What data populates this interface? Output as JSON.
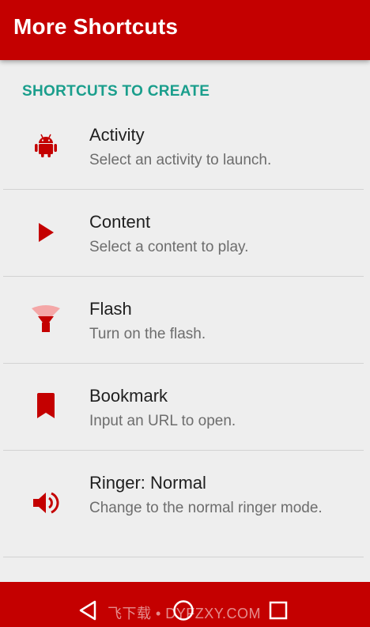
{
  "appbar": {
    "title": "More Shortcuts"
  },
  "section": {
    "header": "SHORTCUTS TO CREATE"
  },
  "items": [
    {
      "icon": "android-icon",
      "title": "Activity",
      "subtitle": "Select an activity to launch."
    },
    {
      "icon": "play-icon",
      "title": "Content",
      "subtitle": "Select a content to play."
    },
    {
      "icon": "flashlight-icon",
      "title": "Flash",
      "subtitle": "Turn on the flash."
    },
    {
      "icon": "bookmark-icon",
      "title": "Bookmark",
      "subtitle": "Input an URL to open."
    },
    {
      "icon": "volume-icon",
      "title": "Ringer: Normal",
      "subtitle": "Change to the normal ringer mode."
    }
  ],
  "navbar": {
    "watermark": "飞下载 • DYFZXY.COM",
    "buttons": [
      "back-icon",
      "home-icon",
      "recents-icon"
    ]
  },
  "colors": {
    "primary": "#c40000",
    "accent": "#1a9e8c",
    "icon": "#c40000",
    "background": "#eeeeee"
  }
}
